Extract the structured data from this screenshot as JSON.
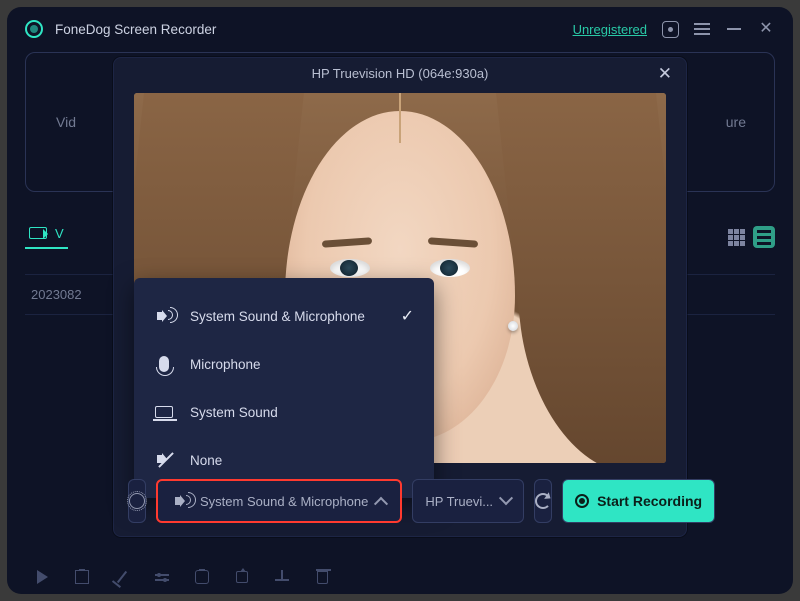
{
  "titlebar": {
    "app_name": "FoneDog Screen Recorder",
    "unregistered": "Unregistered"
  },
  "modes": {
    "video": "Vid",
    "capture": "ure"
  },
  "list": {
    "tab_video": "V",
    "row_name": "2023082"
  },
  "modal": {
    "title": "HP Truevision HD (064e:930a)",
    "audio_menu": {
      "opt1": "System Sound & Microphone",
      "opt2": "Microphone",
      "opt3": "System Sound",
      "opt4": "None"
    },
    "controls": {
      "audio_label": "System Sound & Microphone",
      "device_label": "HP Truevi...",
      "start_label": "Start Recording"
    }
  }
}
